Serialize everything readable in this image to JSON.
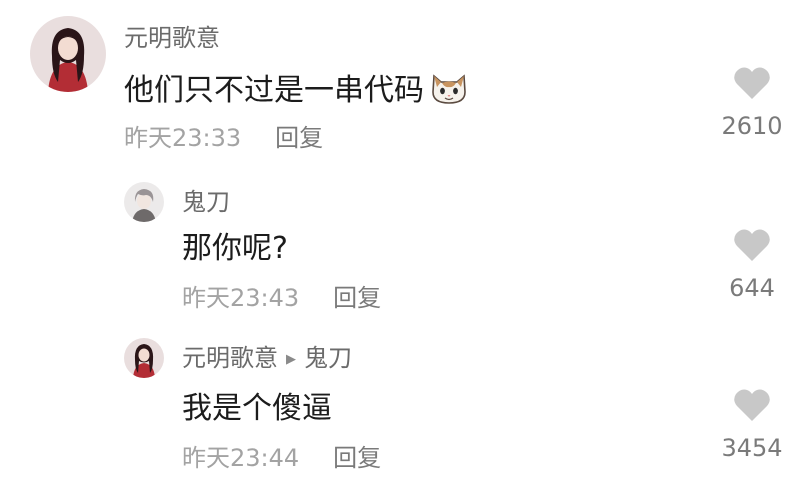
{
  "comments": [
    {
      "author": "元明歌意",
      "text": "他们只不过是一串代码",
      "emoji": "cat-face-emoji",
      "time": "昨天23:33",
      "reply_label": "回复",
      "likes": "2610",
      "avatar": "red-dress-girl-avatar"
    },
    {
      "author": "鬼刀",
      "text": "那你呢?",
      "time": "昨天23:43",
      "reply_label": "回复",
      "likes": "644",
      "avatar": "grey-hair-boy-avatar"
    },
    {
      "author": "元明歌意",
      "reply_to": "鬼刀",
      "text": "我是个傻逼",
      "time": "昨天23:44",
      "reply_label": "回复",
      "likes": "3454",
      "avatar": "red-dress-girl-avatar"
    }
  ],
  "colors": {
    "heart": "#c8c8c8",
    "meta": "#a3a3a3",
    "author": "#6b6b6b",
    "text": "#1c1c1c"
  }
}
